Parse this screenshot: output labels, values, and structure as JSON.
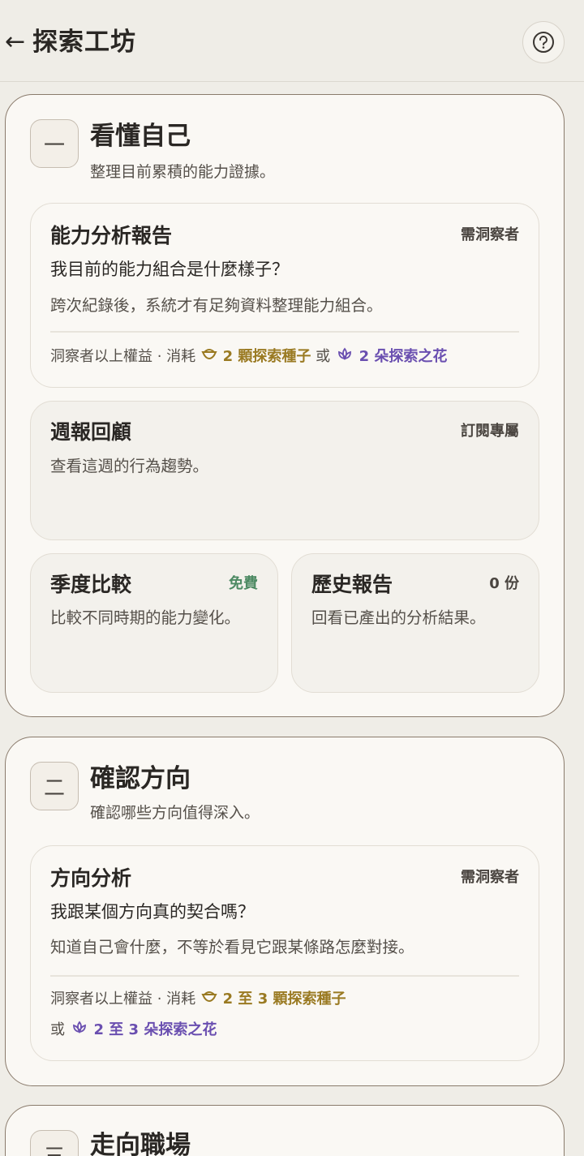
{
  "header": {
    "back_icon": "←",
    "title": "探索工坊",
    "help_icon": "question-circle-icon"
  },
  "sections": [
    {
      "icon": "一",
      "title": "看懂自己",
      "subtitle": "整理目前累積的能力證據。",
      "cards": [
        {
          "title": "能力分析報告",
          "badge": "需洞察者",
          "question": "我目前的能力組合是什麼樣子？",
          "desc": "跨次紀錄後，系統才有足夠資料整理能力組合。",
          "cost_prefix": "洞察者以上權益 · 消耗",
          "seed_text": "2 顆探索種子",
          "or": "或",
          "flower_text": "2 朵探索之花"
        },
        {
          "title": "週報回顧",
          "badge": "訂閱專屬",
          "desc": "查看這週的行為趨勢。"
        },
        {
          "title": "季度比較",
          "badge": "免費",
          "desc": "比較不同時期的能力變化。"
        },
        {
          "title": "歷史報告",
          "badge": "0 份",
          "desc": "回看已產出的分析結果。"
        }
      ]
    },
    {
      "icon": "二",
      "title": "確認方向",
      "subtitle": "確認哪些方向值得深入。",
      "cards": [
        {
          "title": "方向分析",
          "badge": "需洞察者",
          "question": "我跟某個方向真的契合嗎？",
          "desc": "知道自己會什麼，不等於看見它跟某條路怎麼對接。",
          "cost_prefix": "洞察者以上權益 · 消耗",
          "seed_text": "2 至 3 顆探索種子",
          "or": "或",
          "flower_text": "2 至 3 朵探索之花"
        }
      ]
    },
    {
      "icon": "三",
      "title": "走向職場"
    }
  ],
  "colors": {
    "seed": "#9a7a22",
    "flower": "#6a4fb0",
    "free": "#4d8a63",
    "section_border": "#8a7b6c"
  }
}
